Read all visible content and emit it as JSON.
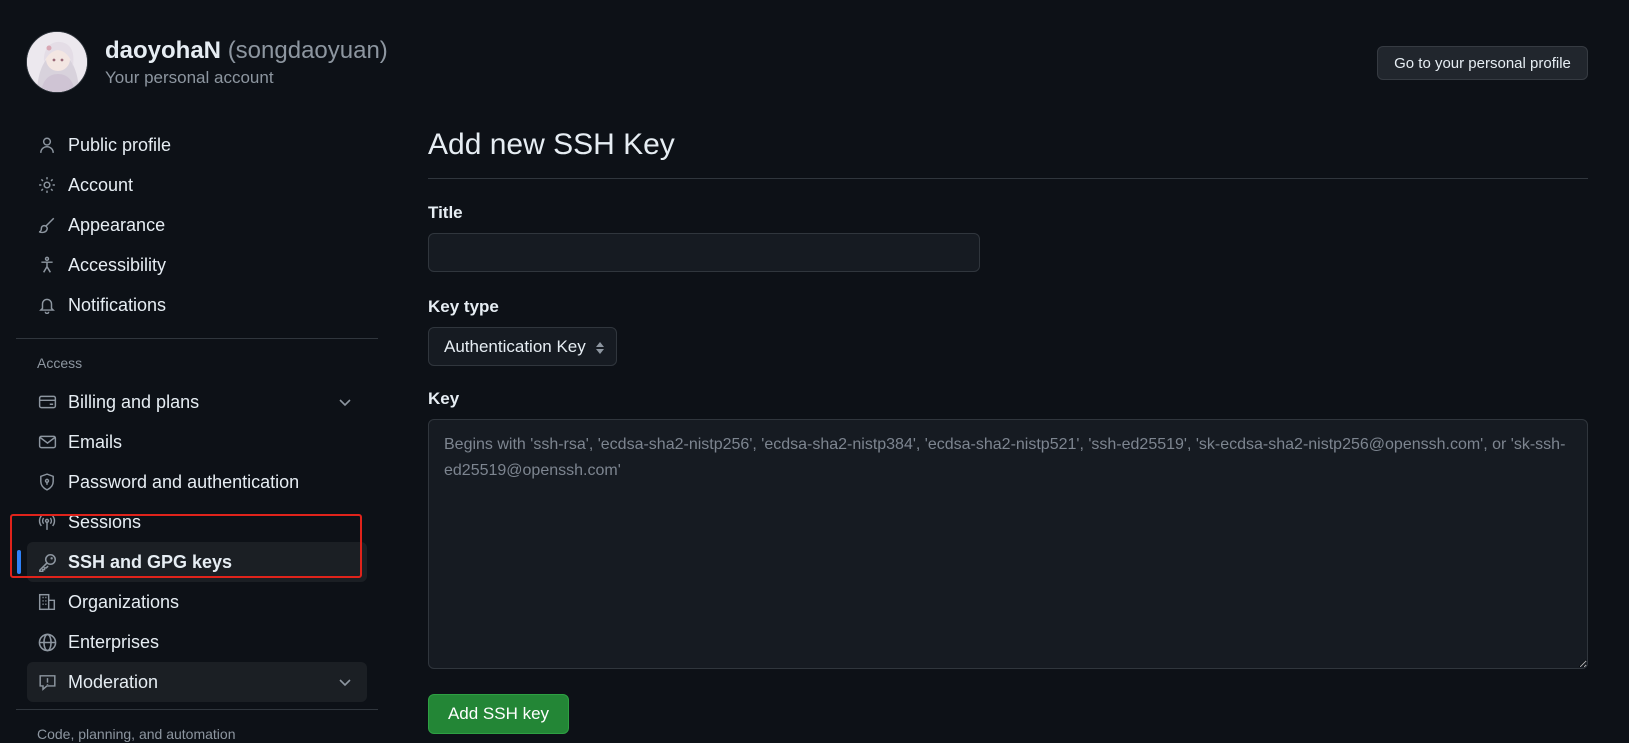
{
  "header": {
    "display_name": "daoyohaN",
    "username": "(songdaoyuan)",
    "subtitle": "Your personal account",
    "profile_button": "Go to your personal profile"
  },
  "sidebar": {
    "top_items": [
      {
        "label": "Public profile",
        "icon": "person-icon"
      },
      {
        "label": "Account",
        "icon": "gear-icon"
      },
      {
        "label": "Appearance",
        "icon": "paintbrush-icon"
      },
      {
        "label": "Accessibility",
        "icon": "accessibility-icon"
      },
      {
        "label": "Notifications",
        "icon": "bell-icon"
      }
    ],
    "access_label": "Access",
    "access_items": [
      {
        "label": "Billing and plans",
        "icon": "credit-card-icon",
        "expandable": true
      },
      {
        "label": "Emails",
        "icon": "mail-icon"
      },
      {
        "label": "Password and authentication",
        "icon": "shield-lock-icon"
      },
      {
        "label": "Sessions",
        "icon": "broadcast-icon"
      },
      {
        "label": "SSH and GPG keys",
        "icon": "key-icon",
        "active": true
      },
      {
        "label": "Organizations",
        "icon": "organization-icon"
      },
      {
        "label": "Enterprises",
        "icon": "globe-icon"
      },
      {
        "label": "Moderation",
        "icon": "report-icon",
        "expandable": true
      }
    ],
    "next_section_label": "Code, planning, and automation"
  },
  "main": {
    "title": "Add new SSH Key",
    "title_field": {
      "label": "Title",
      "value": "",
      "placeholder": ""
    },
    "key_type": {
      "label": "Key type",
      "selected": "Authentication Key"
    },
    "key_field": {
      "label": "Key",
      "placeholder": "Begins with 'ssh-rsa', 'ecdsa-sha2-nistp256', 'ecdsa-sha2-nistp384', 'ecdsa-sha2-nistp521', 'ssh-ed25519', 'sk-ecdsa-sha2-nistp256@openssh.com', or 'sk-ssh-ed25519@openssh.com'"
    },
    "submit_label": "Add SSH key"
  },
  "colors": {
    "background": "#0d1117",
    "accent_blue": "#2f81f7",
    "primary_green": "#238636",
    "highlight_red": "#e0231b"
  }
}
